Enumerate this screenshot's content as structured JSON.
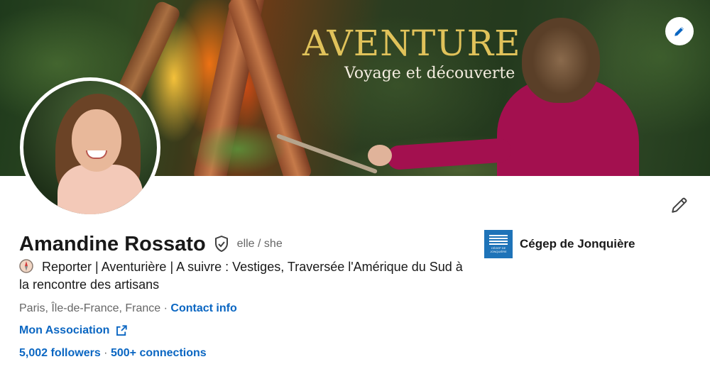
{
  "banner": {
    "title": "AVENTURE",
    "subtitle": "Voyage et découverte",
    "edit_icon": "pencil-icon"
  },
  "profile": {
    "name": "Amandine Rossato",
    "pronouns": "elle / she",
    "verified_icon": "shield-check-icon",
    "headline_icon": "compass-icon",
    "headline": "Reporter | Aventurière | A suivre : Vestiges, Traversée l'Amérique du Sud à la rencontre des artisans",
    "location": "Paris, Île-de-France, France",
    "location_separator": "·",
    "contact_info_label": "Contact info",
    "website_label": "Mon Association",
    "website_icon": "external-link-icon",
    "followers_label": "5,002 followers",
    "network_separator": "·",
    "connections_label": "500+ connections",
    "edit_icon": "pencil-icon"
  },
  "education": {
    "school_name": "Cégep de Jonquière",
    "logo_text_1": "CÉGEP DE",
    "logo_text_2": "JONQUIÈRE"
  },
  "colors": {
    "link": "#0a66c2",
    "text_primary": "#191919",
    "text_secondary": "#666666",
    "banner_title": "#e0c25a",
    "school_logo_bg": "#1e73b8"
  }
}
